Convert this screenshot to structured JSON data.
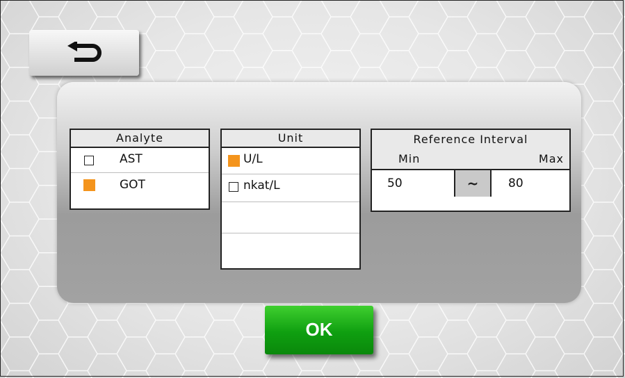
{
  "back_button": {
    "icon": "return-arrow-icon"
  },
  "analyte": {
    "header": "Analyte",
    "items": [
      {
        "label": "AST",
        "checked": false
      },
      {
        "label": "GOT",
        "checked": true
      }
    ]
  },
  "unit": {
    "header": "Unit",
    "items": [
      {
        "label": "U/L",
        "checked": true
      },
      {
        "label": "nkat/L",
        "checked": false
      }
    ]
  },
  "reference": {
    "header": "Reference Interval",
    "min_label": "Min",
    "max_label": "Max",
    "min_value": "50",
    "separator": "~",
    "max_value": "80"
  },
  "ok_button": {
    "label": "OK"
  },
  "colors": {
    "checked": "#f4941c",
    "ok_green": "#1aa81a"
  }
}
